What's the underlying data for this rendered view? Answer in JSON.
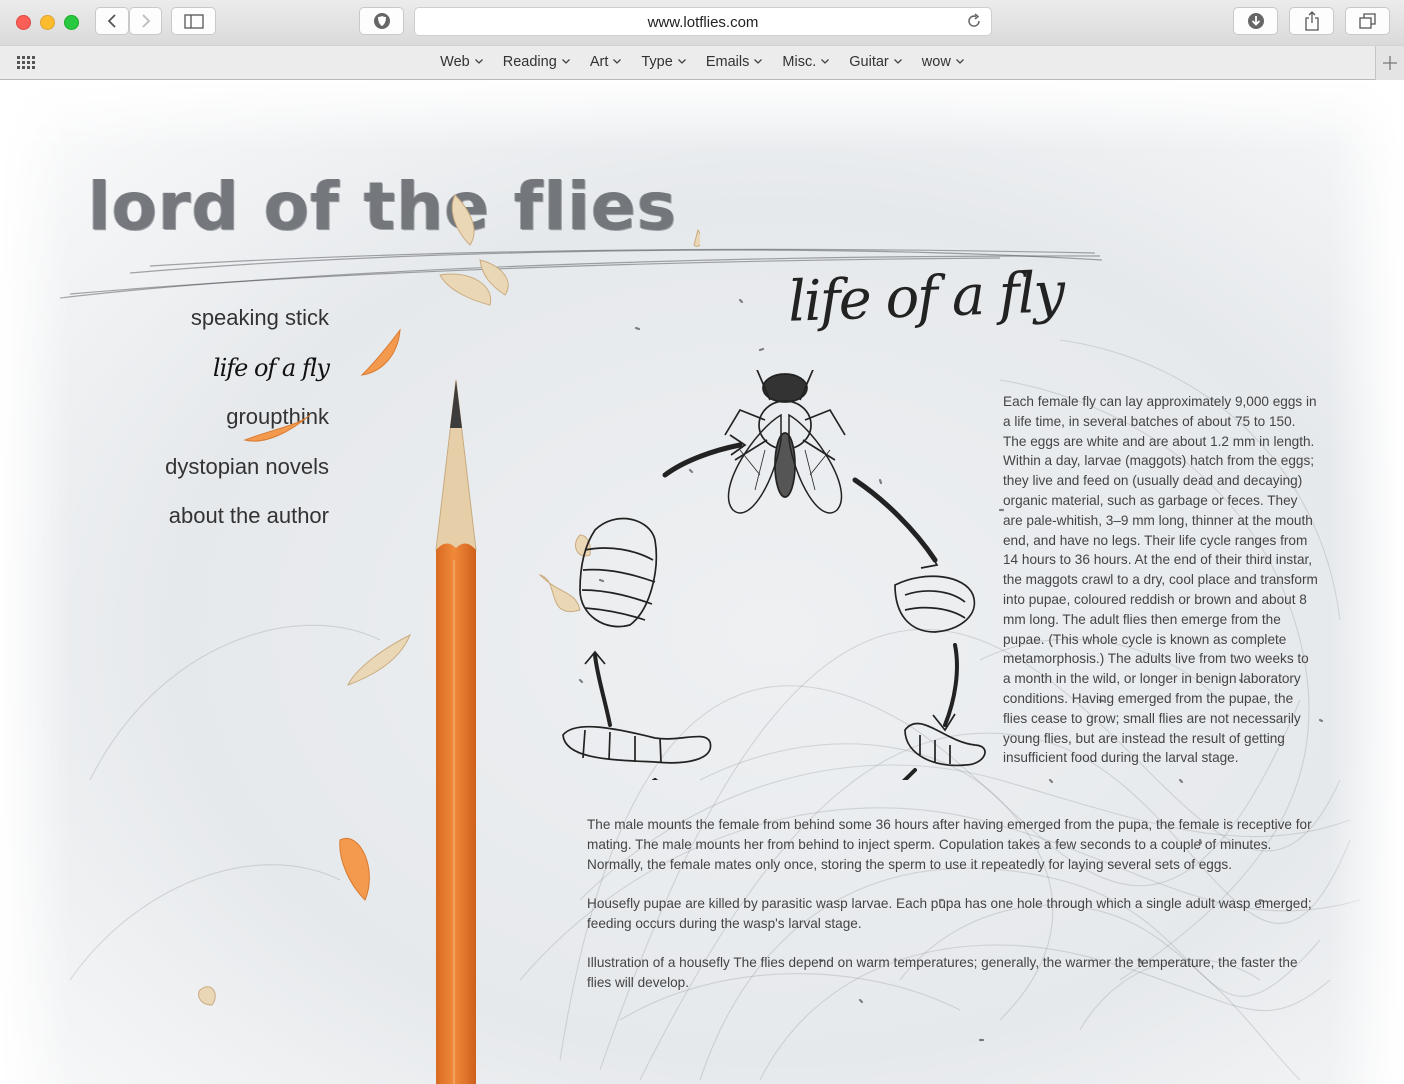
{
  "browser": {
    "url": "www.lotflies.com",
    "icons": [
      "close-button",
      "minimize-button",
      "maximize-button",
      "back-icon",
      "forward-icon",
      "sidebar-icon",
      "privacy-shield-icon",
      "reload-icon",
      "download-icon",
      "share-icon",
      "tabs-icon",
      "apps-grid-icon",
      "plus-icon"
    ]
  },
  "favorites": [
    {
      "label": "Web"
    },
    {
      "label": "Reading"
    },
    {
      "label": "Art"
    },
    {
      "label": "Type"
    },
    {
      "label": "Emails"
    },
    {
      "label": "Misc."
    },
    {
      "label": "Guitar"
    },
    {
      "label": "wow"
    }
  ],
  "site": {
    "title": "lord of the flies",
    "nav": [
      {
        "label": "speaking stick"
      },
      {
        "label": "life of a fly"
      },
      {
        "label": "groupthink"
      },
      {
        "label": "dystopian novels"
      },
      {
        "label": "about the author"
      }
    ]
  },
  "content": {
    "heading": "life of a fly",
    "main_paragraph": "Each female fly can lay approximately 9,000 eggs in a life time, in several batches of about 75 to 150. The eggs are white and are about 1.2 mm in length. Within a day, larvae (maggots) hatch from the eggs; they live and feed on (usually dead and decaying) organic material, such as garbage or feces. They are pale-whitish, 3–9 mm long, thinner at the mouth end, and have no legs. Their life cycle ranges from 14 hours to 36 hours. At the end of their third instar, the maggots crawl to a dry, cool place and transform into pupae, coloured reddish or brown and about 8 mm long. The adult flies then emerge from the pupae. (This whole cycle is known as complete metamorphosis.) The adults live from two weeks to a month in the wild, or longer in benign laboratory conditions. Having emerged from the pupae, the flies cease to grow; small flies are not necessarily young flies, but are instead the result of getting insufficient food during the larval stage.",
    "paragraph_2": "The male mounts the female from behind some 36 hours after having emerged from the pupa, the female is receptive for mating. The male mounts her from behind to inject sperm. Copulation takes a few seconds to a couple of minutes. Normally, the female mates only once, storing the sperm to use it repeatedly for laying several sets of eggs.",
    "paragraph_3": "Housefly pupae are killed by parasitic wasp larvae. Each pupa has one hole through which a single adult wasp emerged; feeding occurs during the wasp's larval stage.",
    "paragraph_4": "Illustration of a housefly The flies depend on warm temperatures; generally, the warmer the temperature, the faster the flies will develop."
  },
  "colors": {
    "pencil_body": "#ec7f33",
    "pencil_wood": "#e9d3b0",
    "graphite": "#3a3a3a",
    "paper": "#e9ecef"
  }
}
